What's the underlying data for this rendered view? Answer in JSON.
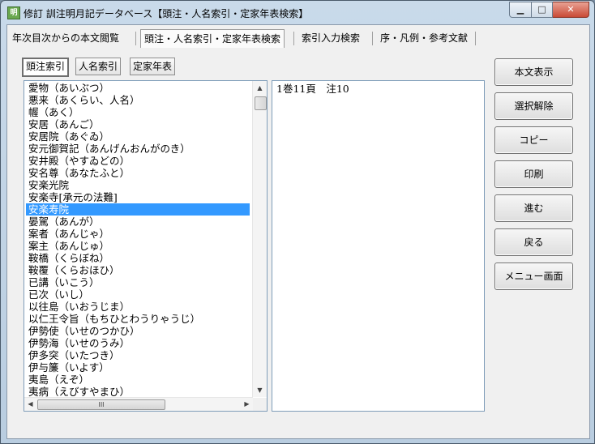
{
  "window": {
    "title": "修訂 訓注明月記データベース【頭注・人名索引・定家年表検索】",
    "app_icon_label": "明",
    "controls": {
      "minimize": "▁",
      "maximize": "□",
      "close": "✕"
    }
  },
  "tabs": [
    {
      "label": "年次目次からの本文閲覧",
      "active": false
    },
    {
      "label": "頭注・人名索引・定家年表検索",
      "active": true
    },
    {
      "label": "索引入力検索",
      "active": false
    },
    {
      "label": "序・凡例・参考文献",
      "active": false
    }
  ],
  "subtabs": [
    {
      "label": "頭注索引",
      "active": true
    },
    {
      "label": "人名索引",
      "active": false
    },
    {
      "label": "定家年表",
      "active": false
    }
  ],
  "list": {
    "selected_index": 10,
    "items": [
      "愛物（あいぶつ）",
      "悪来（あくらい、人名）",
      "幄（あく）",
      "安居（あんご）",
      "安居院（あぐゐ）",
      "安元御賀記（あんげんおんがのき）",
      "安井殿（やすゐどの）",
      "安名尊（あなたふと）",
      "安楽光院",
      "安楽寺[承元の法難]",
      "安楽寿院",
      "晏駕（あんが）",
      "案者（あんじゃ）",
      "案主（あんじゅ）",
      "鞍橋（くらぼね）",
      "鞍覆（くらおほひ）",
      "已講（いこう）",
      "已次（いし）",
      "以往島（いおうじま）",
      "以仁王令旨（もちひとわうりゃうじ）",
      "伊勢使（いせのつかひ）",
      "伊勢海（いせのうみ）",
      "伊多突（いたつき）",
      "伊与簾（いよす）",
      "夷島（えぞ）",
      "夷病（えびすやまひ）"
    ]
  },
  "scrollbars": {
    "up": "▲",
    "down": "▼",
    "left": "◀",
    "right": "▶",
    "hgrip": "III"
  },
  "detail": {
    "text": "1巻11頁　注10"
  },
  "buttons": {
    "show_text": "本文表示",
    "clear_selection": "選択解除",
    "copy": "コピー",
    "print": "印刷",
    "forward": "進む",
    "back": "戻る",
    "menu": "メニュー画面"
  }
}
